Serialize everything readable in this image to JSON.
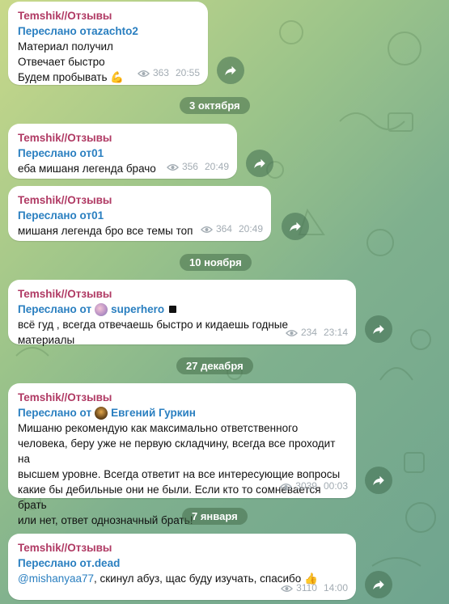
{
  "messages": [
    {
      "channel": "Temshik//Отзывы",
      "forward_prefix": "Переслано от ",
      "forward_from": "azachto2",
      "text": "Материал получил\nОтвечает быстро\nБудем пробывать",
      "emoji": "💪",
      "views": "363",
      "time": "20:55"
    },
    {
      "channel": "Temshik//Отзывы",
      "forward_prefix": "Переслано от ",
      "forward_from": "01",
      "text": "еба мишаня легенда брачо",
      "views": "356",
      "time": "20:49"
    },
    {
      "channel": "Temshik//Отзывы",
      "forward_prefix": "Переслано от ",
      "forward_from": "01",
      "text": "мишаня легенда бро все темы топ",
      "views": "364",
      "time": "20:49"
    },
    {
      "channel": "Temshik//Отзывы",
      "forward_prefix": "Переслано от ",
      "forward_from": "superhero",
      "text": "всё гуд , всегда отвечаешь быстро и кидаешь годные материалы",
      "views": "234",
      "time": "23:14"
    },
    {
      "channel": "Temshik//Отзывы",
      "forward_prefix": "Переслано от ",
      "forward_from": "Евгений Гуркин",
      "text": "Мишаню рекомендую как максимально ответственного\nчеловека, беру уже не первую складчину, всегда все проходит на\nвысшем уровне. Всегда ответит на все интересующие вопросы\nкакие бы дебильные они не были. Если кто то сомневается брать\nили нет, ответ однозначный брать!",
      "views": "3039",
      "time": "00:03"
    },
    {
      "channel": "Temshik//Отзывы",
      "forward_prefix": "Переслано от ",
      "forward_from": ".dead",
      "mention": "@mishanyaa77",
      "text": ", скинул абуз, щас буду изучать, спасибо",
      "emoji": "👍",
      "views": "3110",
      "time": "14:00"
    }
  ],
  "dates": [
    "3 октября",
    "10 ноября",
    "27 декабря",
    "7 января"
  ],
  "colors": {
    "channel": "#b03a64",
    "forward": "#2a7fc0",
    "meta": "#a3acb3"
  }
}
